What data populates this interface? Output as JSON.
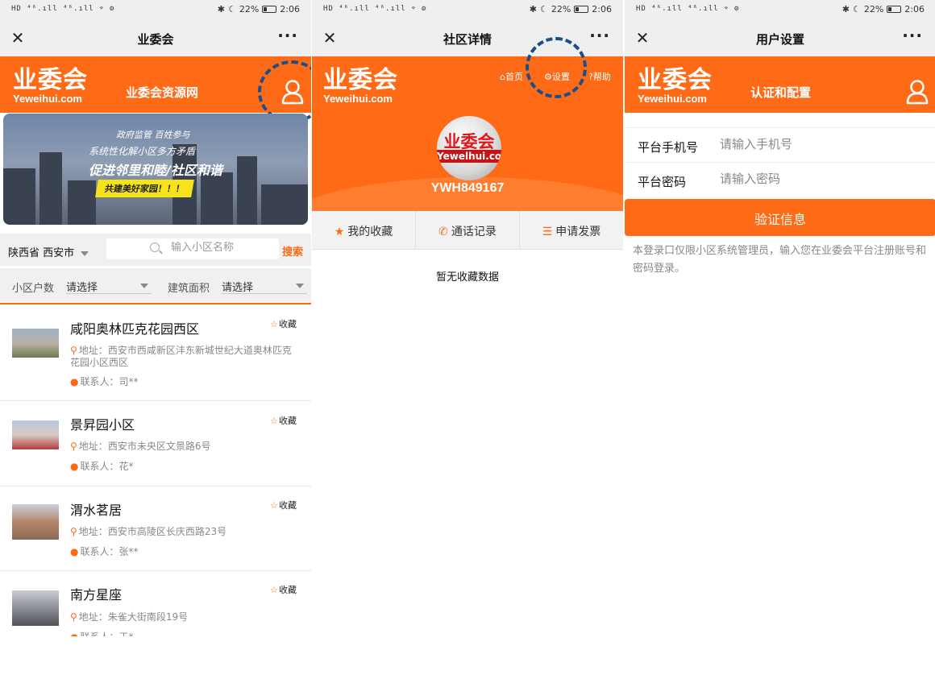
{
  "status_bar": {
    "left": "HD ⁴⁶.ıll ⁴⁶.ıll ⌔ ⚙",
    "battery": "22%",
    "time": "2:06",
    "icons": [
      "bluetooth-icon",
      "moon-icon",
      "battery-icon"
    ]
  },
  "accent_color": "#ff6a17",
  "highlight_circle_color": "#1a4f8a",
  "logo": {
    "zh": "业委会",
    "en": "Yeweihui.com"
  },
  "screen1": {
    "nav_title": "业委会",
    "header_title": "业委会资源网",
    "banner": {
      "line1": "政府监管 百姓参与",
      "line2": "系统性化解小区多方矛盾",
      "line3": "促进邻里和睦/社区和谐",
      "line4": "共建美好家园！！！"
    },
    "region": "陕西省 西安市",
    "search_placeholder": "输入小区名称",
    "search_button": "搜索",
    "filter1_label": "小区户数",
    "filter1_value": "请选择",
    "filter2_label": "建筑面积",
    "filter2_value": "请选择",
    "fav_label": "收藏",
    "address_prefix": "地址：",
    "contact_prefix": "联系人：",
    "items": [
      {
        "name": "咸阳奥林匹克花园西区",
        "address": "西安市西咸新区沣东新城世纪大道奥林匹克花园小区西区",
        "contact": "司**"
      },
      {
        "name": "景昇园小区",
        "address": "西安市未央区文景路6号",
        "contact": "花*"
      },
      {
        "name": "渭水茗居",
        "address": "西安市高陵区长庆西路23号",
        "contact": "张**"
      },
      {
        "name": "南方星座",
        "address": "朱雀大街南段19号",
        "contact": "王*"
      }
    ]
  },
  "screen2": {
    "nav_title": "社区详情",
    "links": {
      "home": "首页",
      "settings": "设置",
      "help": "帮助"
    },
    "avatar": {
      "zh": "业委会",
      "en": "Yewelhui.com"
    },
    "community_id": "YWH849167",
    "tabs": [
      {
        "label": "我的收藏",
        "icon": "star-icon"
      },
      {
        "label": "通话记录",
        "icon": "phone-icon"
      },
      {
        "label": "申请发票",
        "icon": "list-icon"
      }
    ],
    "empty_text": "暂无收藏数据"
  },
  "screen3": {
    "nav_title": "用户设置",
    "header_title": "认证和配置",
    "phone_label": "平台手机号",
    "phone_placeholder": "请输入手机号",
    "password_label": "平台密码",
    "password_placeholder": "请输入密码",
    "verify_button": "验证信息",
    "note": "本登录口仅限小区系统管理员，输入您在业委会平台注册账号和密码登录。"
  }
}
